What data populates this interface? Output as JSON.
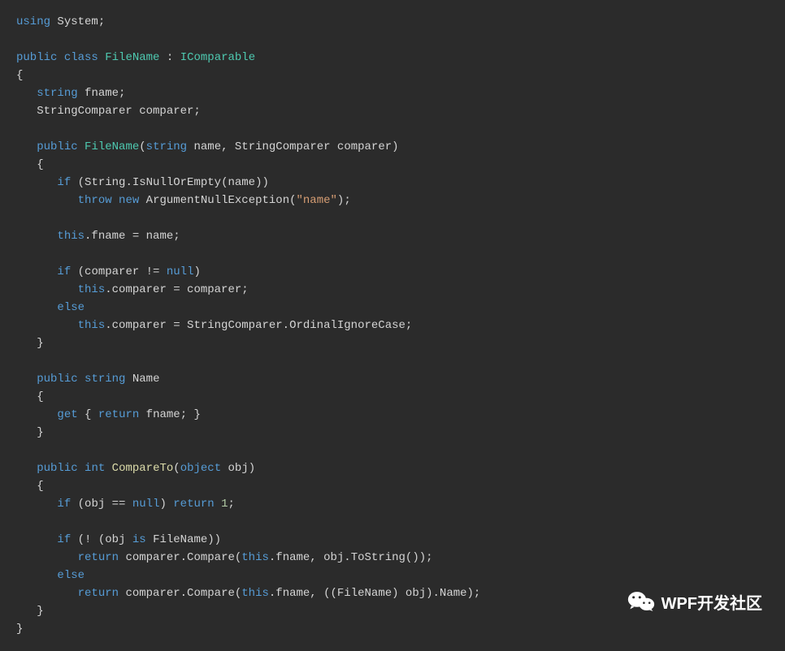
{
  "code": {
    "t": [
      {
        "c": "tok-kw",
        "v": "using"
      },
      {
        "c": "tok-plain",
        "v": " System;"
      },
      {
        "c": "nl"
      },
      {
        "c": "nl"
      },
      {
        "c": "tok-kw",
        "v": "public"
      },
      {
        "c": "tok-plain",
        "v": " "
      },
      {
        "c": "tok-kw",
        "v": "class"
      },
      {
        "c": "tok-plain",
        "v": " "
      },
      {
        "c": "tok-class",
        "v": "FileName"
      },
      {
        "c": "tok-plain",
        "v": " : "
      },
      {
        "c": "tok-class",
        "v": "IComparable"
      },
      {
        "c": "nl"
      },
      {
        "c": "tok-plain",
        "v": "{"
      },
      {
        "c": "nl"
      },
      {
        "c": "tok-plain",
        "v": "   "
      },
      {
        "c": "tok-kw",
        "v": "string"
      },
      {
        "c": "tok-plain",
        "v": " fname;"
      },
      {
        "c": "nl"
      },
      {
        "c": "tok-plain",
        "v": "   StringComparer comparer;"
      },
      {
        "c": "nl"
      },
      {
        "c": "nl"
      },
      {
        "c": "tok-plain",
        "v": "   "
      },
      {
        "c": "tok-kw",
        "v": "public"
      },
      {
        "c": "tok-plain",
        "v": " "
      },
      {
        "c": "tok-class",
        "v": "FileName"
      },
      {
        "c": "tok-plain",
        "v": "("
      },
      {
        "c": "tok-kw",
        "v": "string"
      },
      {
        "c": "tok-plain",
        "v": " name, StringComparer comparer)"
      },
      {
        "c": "nl"
      },
      {
        "c": "tok-plain",
        "v": "   {"
      },
      {
        "c": "nl"
      },
      {
        "c": "tok-plain",
        "v": "      "
      },
      {
        "c": "tok-kw",
        "v": "if"
      },
      {
        "c": "tok-plain",
        "v": " (String.IsNullOrEmpty(name))"
      },
      {
        "c": "nl"
      },
      {
        "c": "tok-plain",
        "v": "         "
      },
      {
        "c": "tok-kw",
        "v": "throw"
      },
      {
        "c": "tok-plain",
        "v": " "
      },
      {
        "c": "tok-kw",
        "v": "new"
      },
      {
        "c": "tok-plain",
        "v": " ArgumentNullException("
      },
      {
        "c": "tok-str",
        "v": "\"name\""
      },
      {
        "c": "tok-plain",
        "v": ");"
      },
      {
        "c": "nl"
      },
      {
        "c": "nl"
      },
      {
        "c": "tok-plain",
        "v": "      "
      },
      {
        "c": "tok-kw",
        "v": "this"
      },
      {
        "c": "tok-plain",
        "v": ".fname = name;"
      },
      {
        "c": "nl"
      },
      {
        "c": "nl"
      },
      {
        "c": "tok-plain",
        "v": "      "
      },
      {
        "c": "tok-kw",
        "v": "if"
      },
      {
        "c": "tok-plain",
        "v": " (comparer != "
      },
      {
        "c": "tok-kw",
        "v": "null"
      },
      {
        "c": "tok-plain",
        "v": ")"
      },
      {
        "c": "nl"
      },
      {
        "c": "tok-plain",
        "v": "         "
      },
      {
        "c": "tok-kw",
        "v": "this"
      },
      {
        "c": "tok-plain",
        "v": ".comparer = comparer;"
      },
      {
        "c": "nl"
      },
      {
        "c": "tok-plain",
        "v": "      "
      },
      {
        "c": "tok-kw",
        "v": "else"
      },
      {
        "c": "nl"
      },
      {
        "c": "tok-plain",
        "v": "         "
      },
      {
        "c": "tok-kw",
        "v": "this"
      },
      {
        "c": "tok-plain",
        "v": ".comparer = StringComparer.OrdinalIgnoreCase;"
      },
      {
        "c": "nl"
      },
      {
        "c": "tok-plain",
        "v": "   }"
      },
      {
        "c": "nl"
      },
      {
        "c": "nl"
      },
      {
        "c": "tok-plain",
        "v": "   "
      },
      {
        "c": "tok-kw",
        "v": "public"
      },
      {
        "c": "tok-plain",
        "v": " "
      },
      {
        "c": "tok-kw",
        "v": "string"
      },
      {
        "c": "tok-plain",
        "v": " Name"
      },
      {
        "c": "nl"
      },
      {
        "c": "tok-plain",
        "v": "   {"
      },
      {
        "c": "nl"
      },
      {
        "c": "tok-plain",
        "v": "      "
      },
      {
        "c": "tok-kw",
        "v": "get"
      },
      {
        "c": "tok-plain",
        "v": " { "
      },
      {
        "c": "tok-kw",
        "v": "return"
      },
      {
        "c": "tok-plain",
        "v": " fname; }"
      },
      {
        "c": "nl"
      },
      {
        "c": "tok-plain",
        "v": "   }"
      },
      {
        "c": "nl"
      },
      {
        "c": "nl"
      },
      {
        "c": "tok-plain",
        "v": "   "
      },
      {
        "c": "tok-kw",
        "v": "public"
      },
      {
        "c": "tok-plain",
        "v": " "
      },
      {
        "c": "tok-kw",
        "v": "int"
      },
      {
        "c": "tok-plain",
        "v": " "
      },
      {
        "c": "tok-method",
        "v": "CompareTo"
      },
      {
        "c": "tok-plain",
        "v": "("
      },
      {
        "c": "tok-kw",
        "v": "object"
      },
      {
        "c": "tok-plain",
        "v": " obj)"
      },
      {
        "c": "nl"
      },
      {
        "c": "tok-plain",
        "v": "   {"
      },
      {
        "c": "nl"
      },
      {
        "c": "tok-plain",
        "v": "      "
      },
      {
        "c": "tok-kw",
        "v": "if"
      },
      {
        "c": "tok-plain",
        "v": " (obj == "
      },
      {
        "c": "tok-kw",
        "v": "null"
      },
      {
        "c": "tok-plain",
        "v": ") "
      },
      {
        "c": "tok-kw",
        "v": "return"
      },
      {
        "c": "tok-plain",
        "v": " "
      },
      {
        "c": "tok-num",
        "v": "1"
      },
      {
        "c": "tok-plain",
        "v": ";"
      },
      {
        "c": "nl"
      },
      {
        "c": "nl"
      },
      {
        "c": "tok-plain",
        "v": "      "
      },
      {
        "c": "tok-kw",
        "v": "if"
      },
      {
        "c": "tok-plain",
        "v": " (! (obj "
      },
      {
        "c": "tok-kw",
        "v": "is"
      },
      {
        "c": "tok-plain",
        "v": " FileName))"
      },
      {
        "c": "nl"
      },
      {
        "c": "tok-plain",
        "v": "         "
      },
      {
        "c": "tok-kw",
        "v": "return"
      },
      {
        "c": "tok-plain",
        "v": " comparer.Compare("
      },
      {
        "c": "tok-kw",
        "v": "this"
      },
      {
        "c": "tok-plain",
        "v": ".fname, obj.ToString());"
      },
      {
        "c": "nl"
      },
      {
        "c": "tok-plain",
        "v": "      "
      },
      {
        "c": "tok-kw",
        "v": "else"
      },
      {
        "c": "nl"
      },
      {
        "c": "tok-plain",
        "v": "         "
      },
      {
        "c": "tok-kw",
        "v": "return"
      },
      {
        "c": "tok-plain",
        "v": " comparer.Compare("
      },
      {
        "c": "tok-kw",
        "v": "this"
      },
      {
        "c": "tok-plain",
        "v": ".fname, ((FileName) obj).Name);"
      },
      {
        "c": "nl"
      },
      {
        "c": "tok-plain",
        "v": "   }"
      },
      {
        "c": "nl"
      },
      {
        "c": "tok-plain",
        "v": "}"
      }
    ]
  },
  "watermark": {
    "text": "WPF开发社区",
    "icon": "wechat-icon"
  },
  "colors": {
    "background": "#2b2b2b",
    "keyword": "#569cd6",
    "class": "#4ec9b0",
    "string": "#d69d73",
    "method": "#dcdcaa",
    "number": "#b5cea8",
    "plain": "#d4d4d4"
  }
}
